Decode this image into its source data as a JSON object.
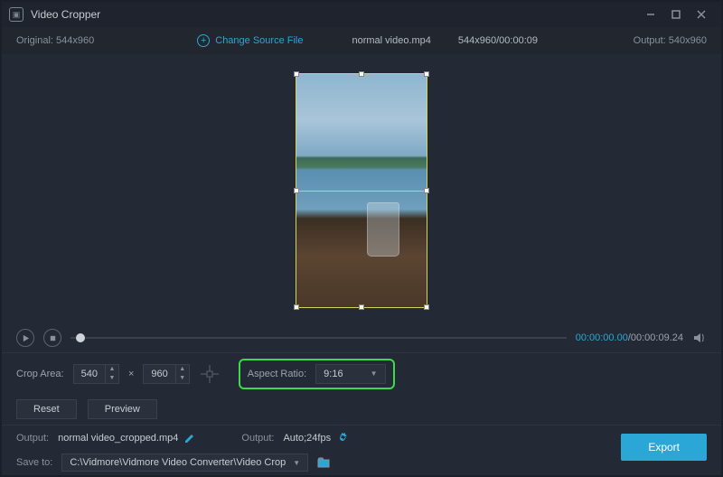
{
  "window": {
    "title": "Video Cropper"
  },
  "info": {
    "original_label": "Original:",
    "original_value": "544x960",
    "change_source_label": "Change Source File",
    "filename": "normal video.mp4",
    "dims_time": "544x960/00:00:09",
    "output_label": "Output:",
    "output_value": "540x960"
  },
  "playback": {
    "current_time": "00:00:00.00",
    "total_time": "/00:00:09.24"
  },
  "crop": {
    "area_label": "Crop Area:",
    "width": "540",
    "times": "×",
    "height": "960",
    "aspect_label": "Aspect Ratio:",
    "aspect_value": "9:16"
  },
  "buttons": {
    "reset": "Reset",
    "preview": "Preview",
    "export": "Export"
  },
  "output": {
    "file_label": "Output:",
    "file_value": "normal video_cropped.mp4",
    "settings_label": "Output:",
    "settings_value": "Auto;24fps",
    "saveto_label": "Save to:",
    "saveto_value": "C:\\Vidmore\\Vidmore Video Converter\\Video Crop"
  }
}
